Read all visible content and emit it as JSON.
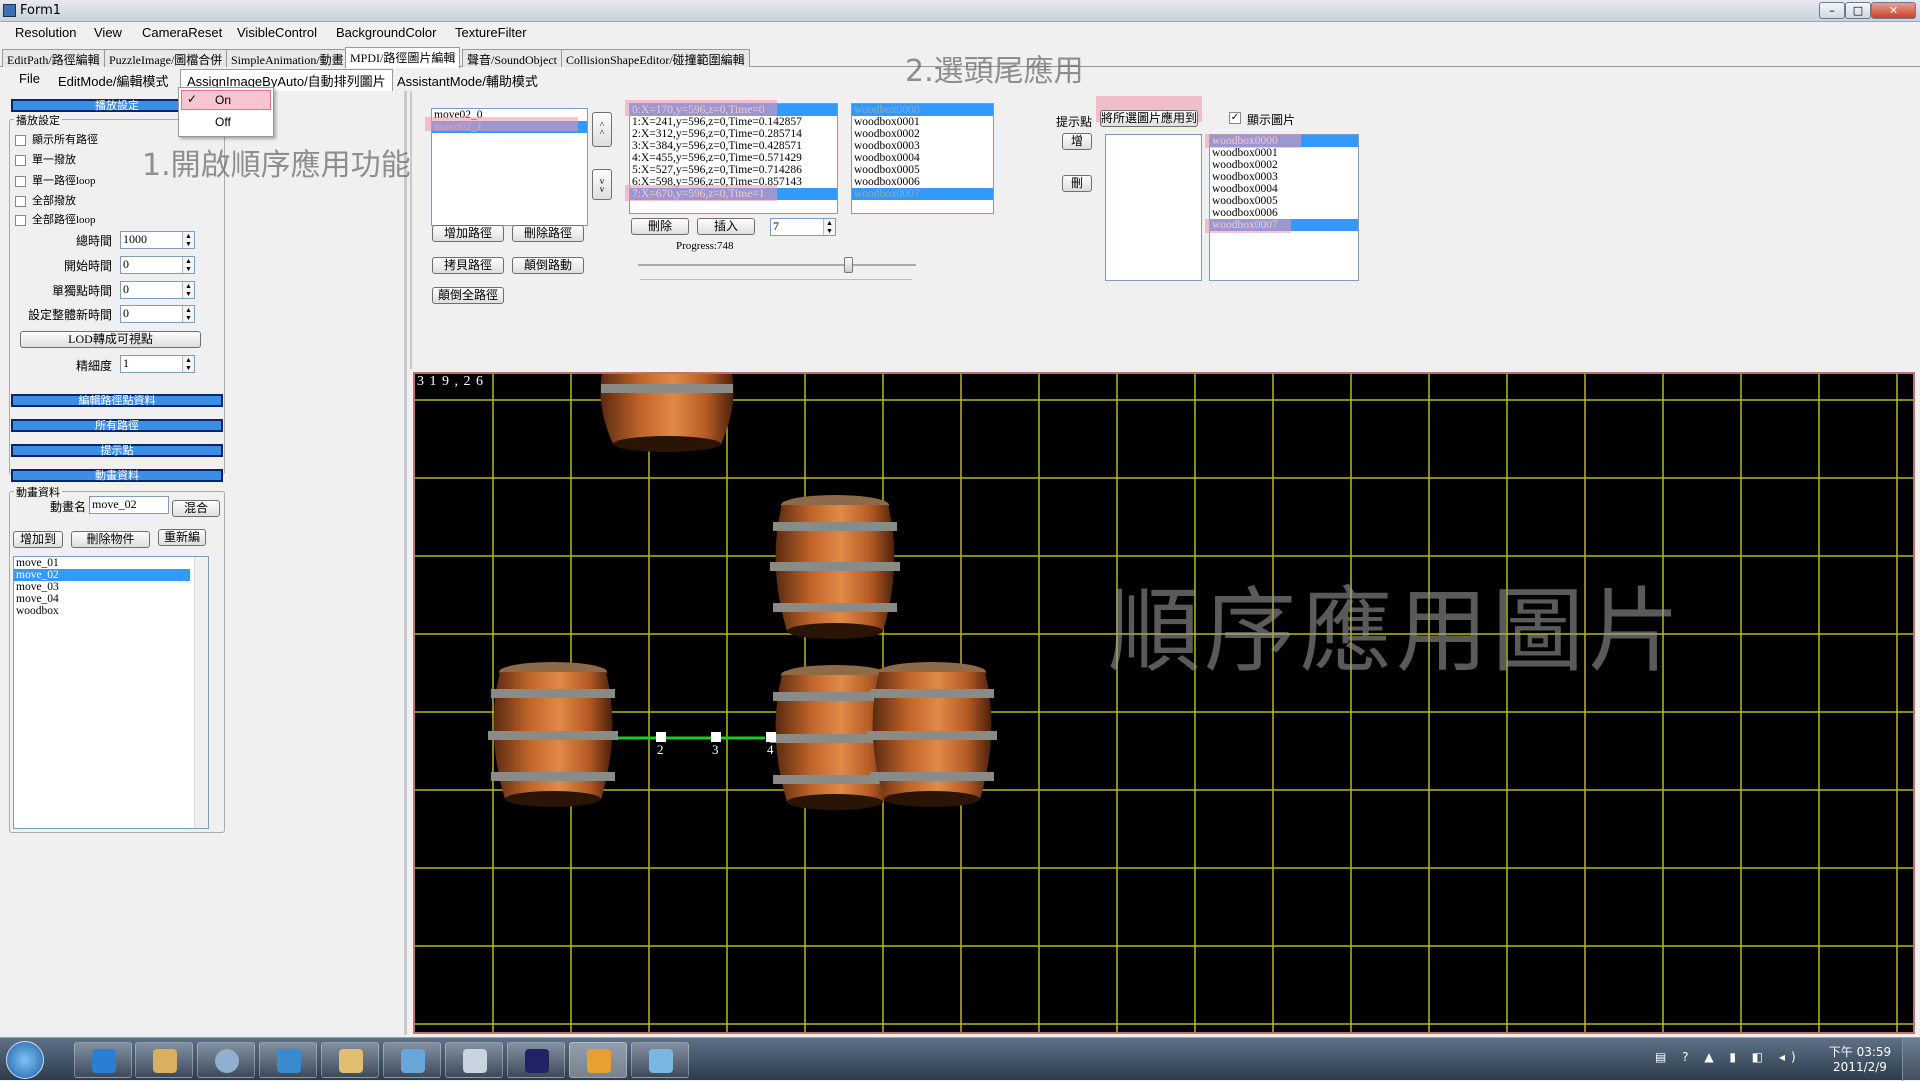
{
  "window": {
    "title": "Form1",
    "minimize": "–",
    "maximize": "□",
    "close": "✕"
  },
  "menu1": [
    "Resolution",
    "View",
    "CameraReset",
    "VisibleControl",
    "BackgroundColor",
    "TextureFilter"
  ],
  "tabs": [
    "EditPath/路徑編輯",
    "PuzzleImage/圖檔合併",
    "SimpleAnimation/動畫",
    "MPDI/路徑圖片編輯",
    "聲音/SoundObject",
    "CollisionShapeEditor/碰撞範圍編輯"
  ],
  "menu2": [
    "File",
    "EditMode/編輯模式",
    "AssignImageByAuto/自動排列圖片",
    "AssistantMode/輔助模式"
  ],
  "dropdown": {
    "on": "On",
    "off": "Off",
    "check": "✓"
  },
  "left": {
    "header1": "播放設定",
    "group1_title": "播放設定",
    "checkboxes": [
      "顯示所有路徑",
      "單一撥放",
      "單一路徑loop",
      "全部撥放",
      "全部路徑loop"
    ],
    "fields": [
      {
        "label": "總時間",
        "value": "1000"
      },
      {
        "label": "開始時間",
        "value": "0"
      },
      {
        "label": "單獨點時間",
        "value": "0"
      },
      {
        "label": "設定整體新時間",
        "value": "0"
      }
    ],
    "lod_button": "LOD轉成可視點",
    "detail_label": "精細度",
    "detail_value": "1",
    "header2": "編輯路徑點資料",
    "header3": "所有路徑",
    "header4": "提示點",
    "header5": "動畫資料",
    "anim_group_title": "動畫資料",
    "anim_name_label": "動畫名",
    "anim_name_value": "move_02",
    "mix_button": "混合",
    "add_button": "增加到",
    "del_button": "刪除物件",
    "reedit_button": "重新編",
    "anim_list": [
      "move_01",
      "move_02",
      "move_03",
      "move_04",
      "woodbox"
    ],
    "anim_selected": 1
  },
  "paths": {
    "list": [
      "move02_0",
      "move02_1"
    ],
    "selected": 1,
    "up": "^\n^",
    "down": "v\nv",
    "add_path": "增加路徑",
    "del_path": "刪除路徑",
    "copy_path": "拷貝路徑",
    "reverse_move": "顛倒路動",
    "reverse_all": "顛倒全路徑"
  },
  "points": {
    "list": [
      "0:X=170,y=596,z=0,Time=0",
      "1:X=241,y=596,z=0,Time=0.142857",
      "2:X=312,y=596,z=0,Time=0.285714",
      "3:X=384,y=596,z=0,Time=0.428571",
      "4:X=455,y=596,z=0,Time=0.571429",
      "5:X=527,y=596,z=0,Time=0.714286",
      "6:X=598,y=596,z=0,Time=0.857143",
      "7:X=670,y=596,z=0,Time=1"
    ],
    "delete": "刪除",
    "insert": "插入",
    "count": "7",
    "progress": "Progress:748",
    "slider_fraction": 0.74
  },
  "images1": [
    "woodbox0000",
    "woodbox0001",
    "woodbox0002",
    "woodbox0003",
    "woodbox0004",
    "woodbox0005",
    "woodbox0006",
    "woodbox0007"
  ],
  "hint": {
    "label": "提示點",
    "apply_button": "將所選圖片應用到",
    "add": "增",
    "del": "刪",
    "show_images": "顯示圖片"
  },
  "images2": [
    "woodbox0000",
    "woodbox0001",
    "woodbox0002",
    "woodbox0003",
    "woodbox0004",
    "woodbox0005",
    "woodbox0006",
    "woodbox0007"
  ],
  "viewport": {
    "coords": "3 1 9 , 2 6",
    "point_labels": [
      "2",
      "3",
      "4"
    ],
    "grid_color": "#b8b820",
    "bg_color": "#000000"
  },
  "annotations": {
    "step1": "1.開啟順序應用功能",
    "step2": "2.選頭尾應用",
    "big": "順序應用圖片"
  },
  "taskbar": {
    "time": "下午 03:59",
    "date": "2011/2/9"
  }
}
